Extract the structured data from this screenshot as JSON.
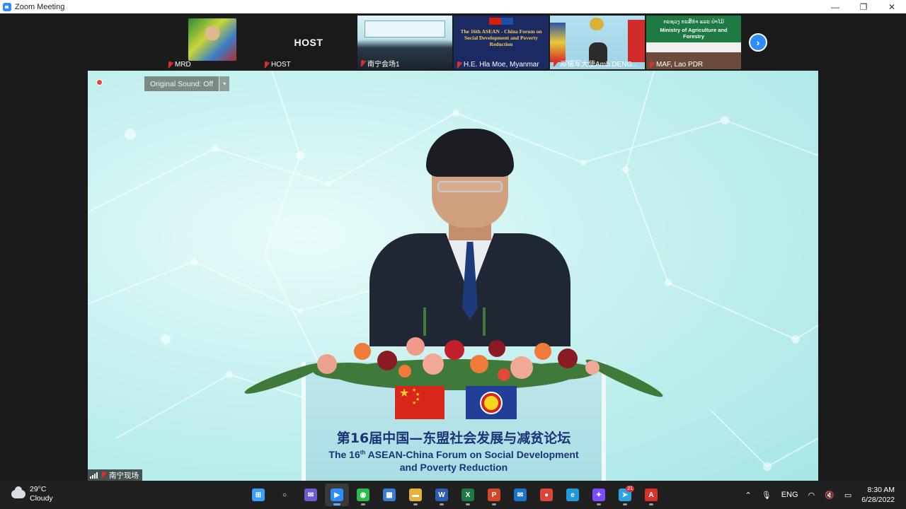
{
  "window": {
    "title": "Zoom Meeting",
    "minimize": "—",
    "restore": "❐",
    "close": "✕"
  },
  "thumbnails": [
    {
      "label": "MRD"
    },
    {
      "label": "HOST",
      "center_text": "HOST"
    },
    {
      "label": "南宁会场1"
    },
    {
      "label": "H.E. Hla Moe, Myanmar",
      "banner_line1": "The 16th ASEAN - China Forum on",
      "banner_line2": "Social Development and Poverty Reduction"
    },
    {
      "label": "邓锡军大使Amb.DENG..."
    },
    {
      "label": "MAF, Lao PDR",
      "banner_line1": "ກະຊວງ ກະສິກຳ ແລະ ປ່າໄມ້",
      "banner_line2": "Ministry of Agriculture and Forestry"
    }
  ],
  "next_icon": "›",
  "main_video": {
    "original_sound": "Original Sound: Off",
    "dropdown_icon": "▾",
    "participant_label": "南宁现场",
    "podium_title_cn": "第16届中国—东盟社会发展与减贫论坛",
    "podium_title_en_prefix": "The 16",
    "podium_title_en_sup": "th",
    "podium_title_en_rest": " ASEAN-China Forum on Social Development",
    "podium_title_en_line2": "and Poverty Reduction"
  },
  "taskbar": {
    "weather_temp": "29°C",
    "weather_desc": "Cloudy",
    "apps": [
      {
        "name": "start-button",
        "glyph": "⊞",
        "color": "#3aa0ff"
      },
      {
        "name": "search-button",
        "glyph": "○",
        "color": "#202020"
      },
      {
        "name": "chat-app",
        "glyph": "✉",
        "color": "#6d5bd0"
      },
      {
        "name": "zoom-app",
        "glyph": "▶",
        "color": "#2d8cff"
      },
      {
        "name": "wechat-app",
        "glyph": "◉",
        "color": "#2dbb4e"
      },
      {
        "name": "store-app",
        "glyph": "▦",
        "color": "#3a7bd5"
      },
      {
        "name": "file-explorer-app",
        "glyph": "▬",
        "color": "#e6b23a"
      },
      {
        "name": "word-app",
        "glyph": "W",
        "color": "#2b5eb8"
      },
      {
        "name": "excel-app",
        "glyph": "X",
        "color": "#1e7a45"
      },
      {
        "name": "powerpoint-app",
        "glyph": "P",
        "color": "#d24726"
      },
      {
        "name": "mail-app",
        "glyph": "✉",
        "color": "#1a73c8"
      },
      {
        "name": "chrome-app",
        "glyph": "●",
        "color": "#db4437"
      },
      {
        "name": "edge-app",
        "glyph": "e",
        "color": "#1f9bd8"
      },
      {
        "name": "messenger-app",
        "glyph": "✦",
        "color": "#7c4dff"
      },
      {
        "name": "telegram-app",
        "glyph": "➤",
        "color": "#2ba3e0",
        "badge": "21"
      },
      {
        "name": "pdf-app",
        "glyph": "A",
        "color": "#d9322b"
      }
    ],
    "language": "ENG",
    "time": "8:30 AM",
    "date": "6/28/2022"
  }
}
